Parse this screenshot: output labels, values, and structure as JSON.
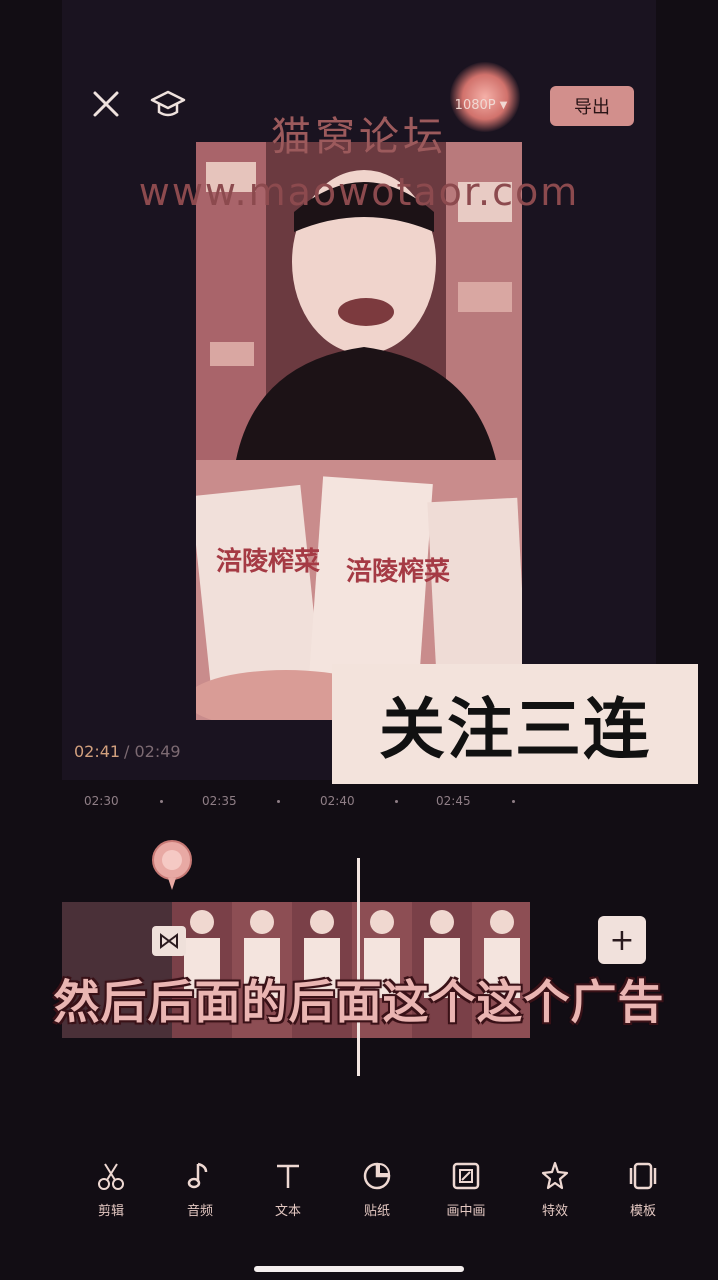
{
  "topbar": {
    "resolution_label": "1080P",
    "export_label": "导出"
  },
  "watermark": {
    "title": "猫窝论坛",
    "url": "www.maowotaor.com"
  },
  "preview": {
    "overlay_text": "关注三连",
    "current_time": "02:41",
    "total_time": "/ 02:49"
  },
  "ruler": {
    "ticks": [
      "02:30",
      "02:35",
      "02:40",
      "02:45"
    ]
  },
  "timeline": {
    "subtitle": "然后后面的后面这个这个广告"
  },
  "toolbar": {
    "items": [
      {
        "label": "剪辑",
        "icon": "scissors-icon"
      },
      {
        "label": "音频",
        "icon": "music-note-icon"
      },
      {
        "label": "文本",
        "icon": "text-icon"
      },
      {
        "label": "贴纸",
        "icon": "sticker-icon"
      },
      {
        "label": "画中画",
        "icon": "picture-in-picture-icon"
      },
      {
        "label": "特效",
        "icon": "sparkle-star-icon"
      },
      {
        "label": "模板",
        "icon": "template-icon"
      }
    ]
  },
  "colors": {
    "background": "#120d14",
    "accent": "#d28f8c",
    "subtitle": "#eab5b2"
  }
}
